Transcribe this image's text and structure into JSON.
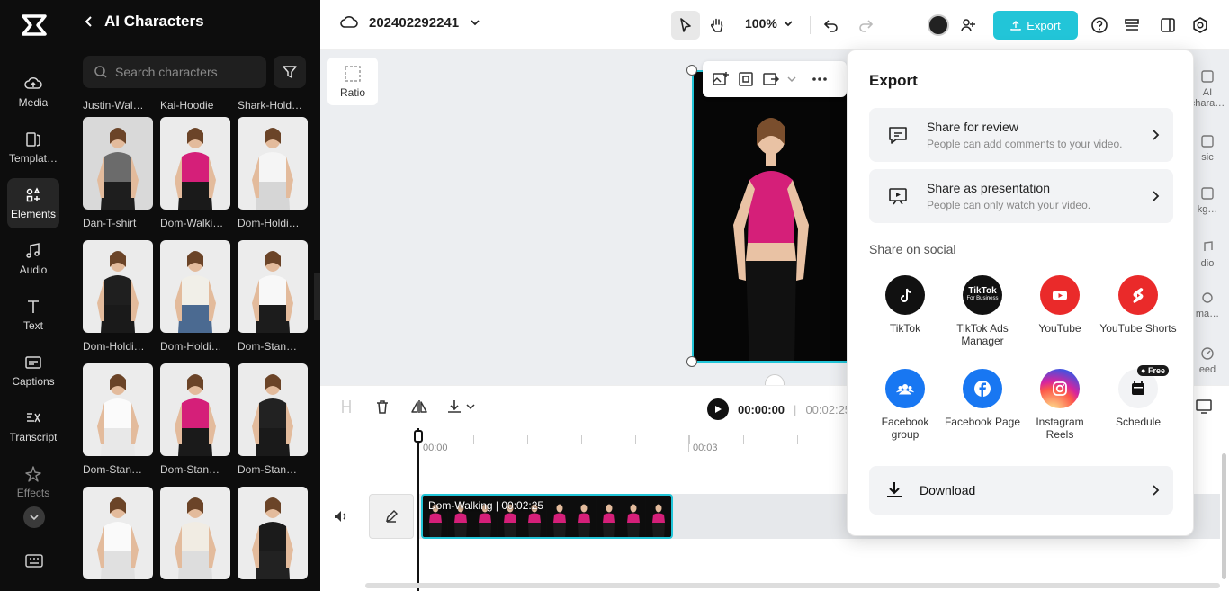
{
  "rail": {
    "items": [
      {
        "label": "Media",
        "icon": "cloud-icon"
      },
      {
        "label": "Templat…",
        "icon": "template-icon"
      },
      {
        "label": "Elements",
        "icon": "elements-icon"
      },
      {
        "label": "Audio",
        "icon": "music-icon"
      },
      {
        "label": "Text",
        "icon": "text-icon"
      },
      {
        "label": "Captions",
        "icon": "captions-icon"
      },
      {
        "label": "Transcript",
        "icon": "transcript-icon"
      },
      {
        "label": "Effects",
        "icon": "effects-icon"
      }
    ],
    "active": "Elements"
  },
  "panel": {
    "title": "AI Characters",
    "search_placeholder": "Search characters",
    "top_labels": [
      "Justin-Wal…",
      "Kai-Hoodie",
      "Shark-Hold…"
    ],
    "characters": [
      {
        "name": "Dan-T-shirt",
        "top": "#6b6b6b",
        "bottom": "#1e1e1e",
        "bg": "#d9d9d9"
      },
      {
        "name": "Dom-Walki…",
        "top": "#d51f79",
        "bottom": "#1a1a1a",
        "bg": "#ebebeb"
      },
      {
        "name": "Dom-Holdi…",
        "top": "#f5f5f5",
        "bottom": "#d6d6d6",
        "bg": "#ececec"
      },
      {
        "name": "Dom-Holdi…",
        "top": "#1f1f1f",
        "bottom": "#1a1a1a",
        "bg": "#ebebeb"
      },
      {
        "name": "Dom-Holdi…",
        "top": "#f1efe8",
        "bottom": "#4b6a91",
        "bg": "#ececec"
      },
      {
        "name": "Dom-Stan…",
        "top": "#f8f8f8",
        "bottom": "#1c1c1c",
        "bg": "#ececec"
      },
      {
        "name": "Dom-Stan…",
        "top": "#fbfbfb",
        "bottom": "#e8e8e8",
        "bg": "#ececec"
      },
      {
        "name": "Dom-Stan…",
        "top": "#d51f79",
        "bottom": "#1a1a1a",
        "bg": "#ebebeb"
      },
      {
        "name": "Dom-Stan…",
        "top": "#222222",
        "bottom": "#1a1a1a",
        "bg": "#ebebeb"
      },
      {
        "name": "",
        "top": "#fafafa",
        "bottom": "#e0e0e0",
        "bg": "#ececec"
      },
      {
        "name": "",
        "top": "#f1ece3",
        "bottom": "#ddd",
        "bg": "#ececec"
      },
      {
        "name": "",
        "top": "#1b1b1b",
        "bottom": "#222",
        "bg": "#ececec"
      }
    ]
  },
  "topbar": {
    "project_name": "202402292241",
    "zoom": "100%",
    "export_label": "Export"
  },
  "canvas": {
    "ratio_label": "Ratio"
  },
  "timeline": {
    "current_time": "00:00:00",
    "total_time": "00:02:25",
    "ruler": [
      "00:00",
      "00:03"
    ],
    "clip_label": "Dom-Walking",
    "clip_duration": "00:02:25"
  },
  "right_panel": [
    "AI\nchara…",
    "sic",
    "kg…",
    "dio",
    "ma…",
    "eed"
  ],
  "export_popup": {
    "title": "Export",
    "review": {
      "title": "Share for review",
      "subtitle": "People can add comments to your video."
    },
    "presentation": {
      "title": "Share as presentation",
      "subtitle": "People can only watch your video."
    },
    "social_label": "Share on social",
    "social": [
      {
        "name": "TikTok",
        "color": "#111111",
        "icon": "tiktok-icon"
      },
      {
        "name": "TikTok Ads Manager",
        "color": "#111111",
        "icon": "tiktok-business-icon",
        "badge_text": "TikTok",
        "badge_sub": "For Business"
      },
      {
        "name": "YouTube",
        "color": "#ea2a2a",
        "icon": "youtube-icon"
      },
      {
        "name": "YouTube Shorts",
        "color": "#ea2a2a",
        "icon": "youtube-shorts-icon"
      },
      {
        "name": "Facebook group",
        "color": "#1877f2",
        "icon": "facebook-group-icon"
      },
      {
        "name": "Facebook Page",
        "color": "#1877f2",
        "icon": "facebook-icon"
      },
      {
        "name": "Instagram Reels",
        "color": "#d62976",
        "icon": "instagram-icon"
      },
      {
        "name": "Schedule",
        "color": "#f2f3f5",
        "icon": "calendar-icon",
        "badge": "Free"
      }
    ],
    "download_label": "Download"
  }
}
